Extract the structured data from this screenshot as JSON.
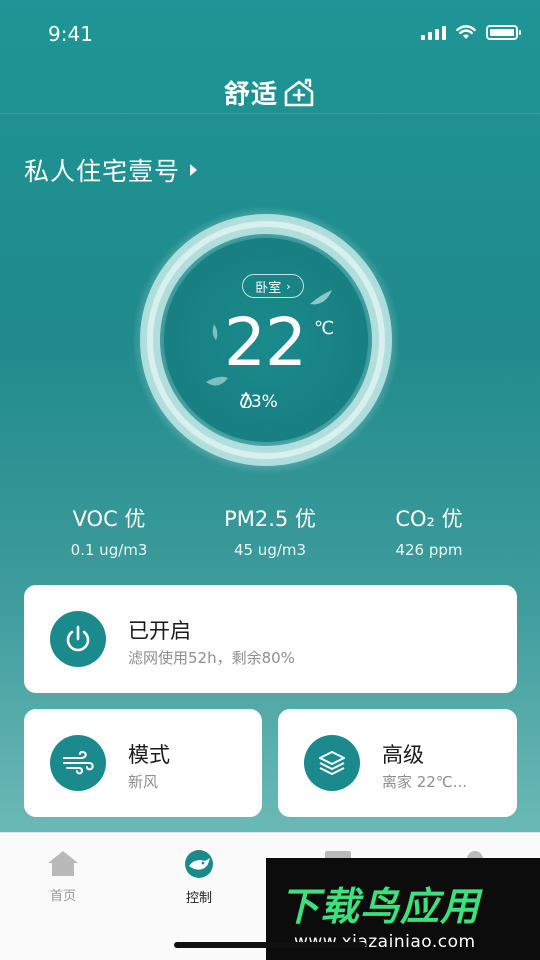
{
  "status_bar": {
    "time": "9:41"
  },
  "header": {
    "app_name": "舒适"
  },
  "residence": {
    "name": "私人住宅壹号"
  },
  "gauge": {
    "room": "卧室",
    "temperature": "22",
    "temperature_unit": "℃",
    "humidity": "73%"
  },
  "metrics": [
    {
      "title": "VOC 优",
      "value": "0.1 ug/m3"
    },
    {
      "title": "PM2.5 优",
      "value": "45 ug/m3"
    },
    {
      "title": "CO₂ 优",
      "value": "426 ppm"
    }
  ],
  "power_card": {
    "title": "已开启",
    "subtitle": "滤网使用52h，剩余80%"
  },
  "mode_card": {
    "title": "模式",
    "subtitle": "新风"
  },
  "advanced_card": {
    "title": "高级",
    "subtitle": "离家 22℃..."
  },
  "tab_bar": {
    "tabs": [
      {
        "label": "首页",
        "icon": "home-icon"
      },
      {
        "label": "控制",
        "icon": "control-icon"
      }
    ]
  },
  "watermark": {
    "logo": "下载鸟应用",
    "url": "www.xiazainiao.com"
  },
  "colors": {
    "accent": "#1b8a8c",
    "watermark_green": "#3ce07c"
  }
}
